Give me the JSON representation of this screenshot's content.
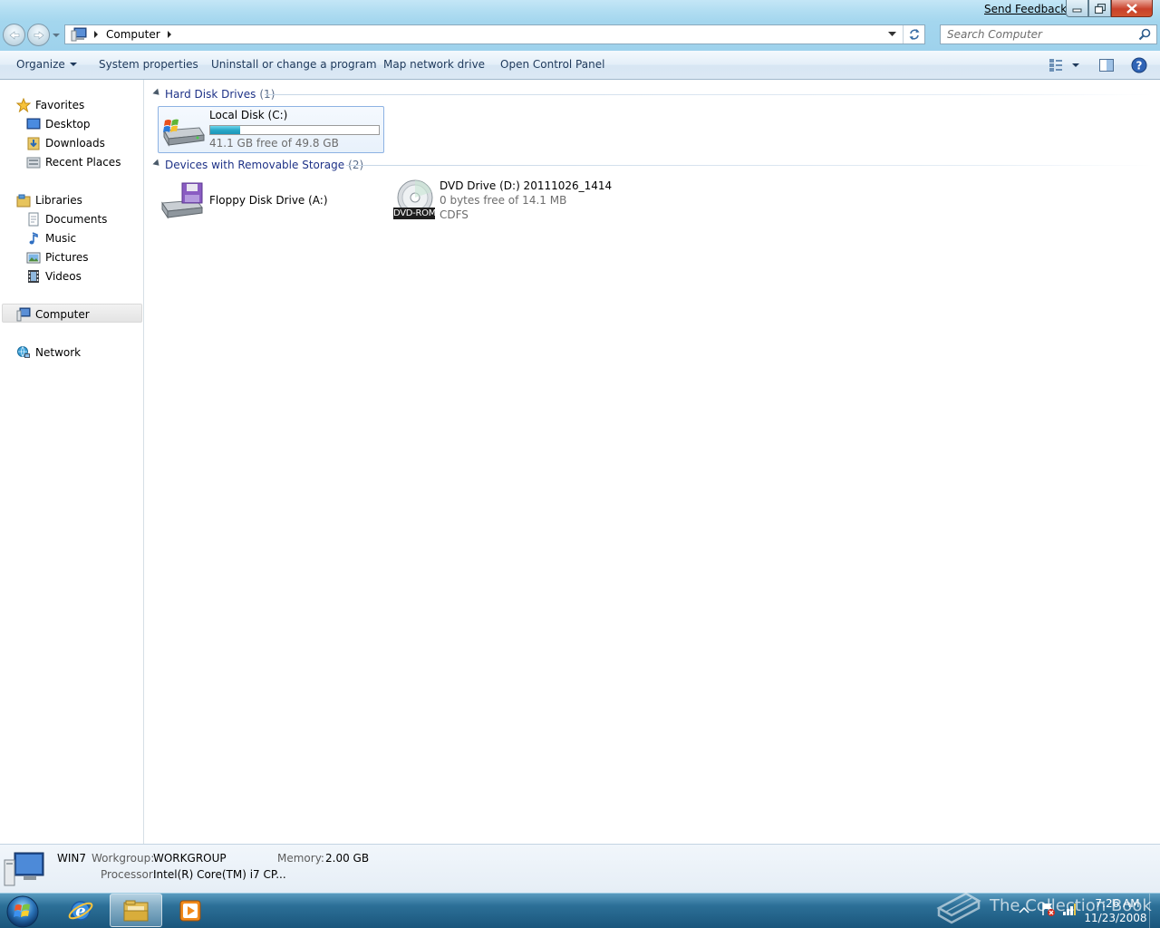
{
  "window": {
    "send_feedback": "Send Feedback"
  },
  "address": {
    "crumb": "Computer",
    "search_placeholder": "Search Computer"
  },
  "commands": {
    "organize": "Organize",
    "system_properties": "System properties",
    "uninstall": "Uninstall or change a program",
    "map_drive": "Map network drive",
    "control_panel": "Open Control Panel"
  },
  "nav": {
    "favorites": "Favorites",
    "favorites_items": [
      "Desktop",
      "Downloads",
      "Recent Places"
    ],
    "libraries": "Libraries",
    "library_items": [
      "Documents",
      "Music",
      "Pictures",
      "Videos"
    ],
    "computer": "Computer",
    "network": "Network"
  },
  "groups": {
    "hdd": {
      "label": "Hard Disk Drives",
      "count": "(1)"
    },
    "removable": {
      "label": "Devices with Removable Storage",
      "count": "(2)"
    }
  },
  "drives": {
    "local": {
      "name": "Local Disk (C:)",
      "free": "41.1 GB free of 49.8 GB",
      "used_fraction": 0.175
    },
    "floppy": {
      "name": "Floppy Disk Drive (A:)"
    },
    "dvd": {
      "name": "DVD Drive (D:) 20111026_1414",
      "free": "0 bytes free of 14.1 MB",
      "fs": "CDFS",
      "badge": "DVD-ROM"
    }
  },
  "details": {
    "computer_name": "WIN7",
    "workgroup_key": "Workgroup:",
    "workgroup_val": "WORKGROUP",
    "memory_key": "Memory:",
    "memory_val": "2.00 GB",
    "processor_key": "Processor:",
    "processor_val": "Intel(R) Core(TM) i7 CP..."
  },
  "taskbar": {
    "time": "7:26 AM",
    "date": "11/23/2008",
    "watermark": "The Collection Book"
  },
  "colors": {
    "accent": "#1e395b",
    "group_header": "#1e3287",
    "usage_bar": "#2aa8c8",
    "taskbar": "#1a567c"
  }
}
